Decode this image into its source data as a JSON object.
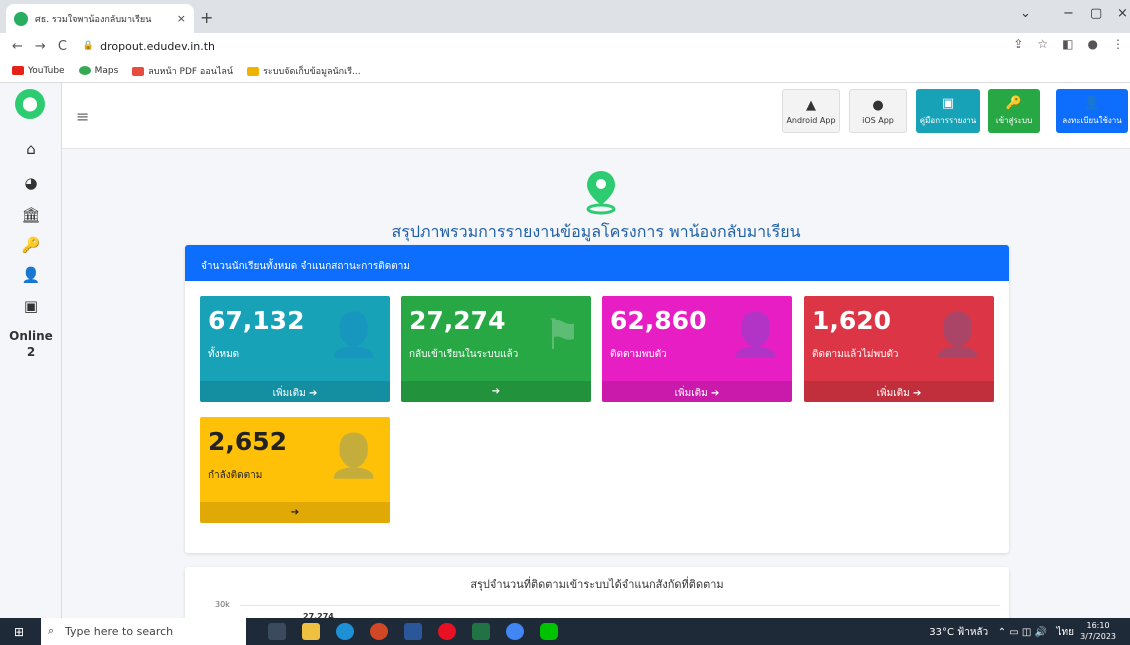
{
  "browser": {
    "tab_title": "ศธ. รวมใจพาน้องกลับมาเรียน",
    "tab_close": "×",
    "new_tab": "+",
    "url": "dropout.edudev.in.th",
    "bookmarks": [
      "YouTube",
      "Maps",
      "ลบหน้า PDF ออนไลน์",
      "ระบบจัดเก็บข้อมูลนักเรี..."
    ]
  },
  "sidebar": {
    "online_label": "Online",
    "online_count": "2"
  },
  "topnav": {
    "buttons": [
      {
        "label": "Android App"
      },
      {
        "label": "iOS App"
      },
      {
        "label": "คู่มือการรายงาน"
      },
      {
        "label": "เข้าสู่ระบบ"
      },
      {
        "label": "ลงทะเบียนใช้งาน"
      }
    ]
  },
  "main": {
    "headline": "สรุปภาพรวมการรายงานข้อมูลโครงการ พาน้องกลับมาเรียน",
    "card_header": "จำนวนนักเรียนทั้งหมด จำแนกสถานะการติดตาม",
    "stats": [
      {
        "value": "67,132",
        "label": "ทั้งหมด",
        "footer": "เพิ่มเติม ➔",
        "color": "#17a2b8"
      },
      {
        "value": "27,274",
        "label": "กลับเข้าเรียนในระบบแล้ว",
        "footer": "➔",
        "color": "#28a745"
      },
      {
        "value": "62,860",
        "label": "ติดตามพบตัว",
        "footer": "เพิ่มเติม ➔",
        "color": "#e61ec3"
      },
      {
        "value": "1,620",
        "label": "ติดตามแล้วไม่พบตัว",
        "footer": "เพิ่มเติม ➔",
        "color": "#dc3545"
      },
      {
        "value": "2,652",
        "label": "กำลังติดตาม",
        "footer": "➔",
        "color": "#ffc107"
      }
    ],
    "chart_title": "สรุปจำนวนที่ติดตามเข้าระบบได้จำแนกสังกัดที่ติดตาม",
    "chart_ytick": "30k",
    "chart_label": "27,274"
  },
  "taskbar": {
    "search_placeholder": "Type here to search",
    "weather": "33°C ฟ้าหลัว",
    "lang": "ไทย",
    "time": "16:10",
    "date": "3/7/2023"
  }
}
